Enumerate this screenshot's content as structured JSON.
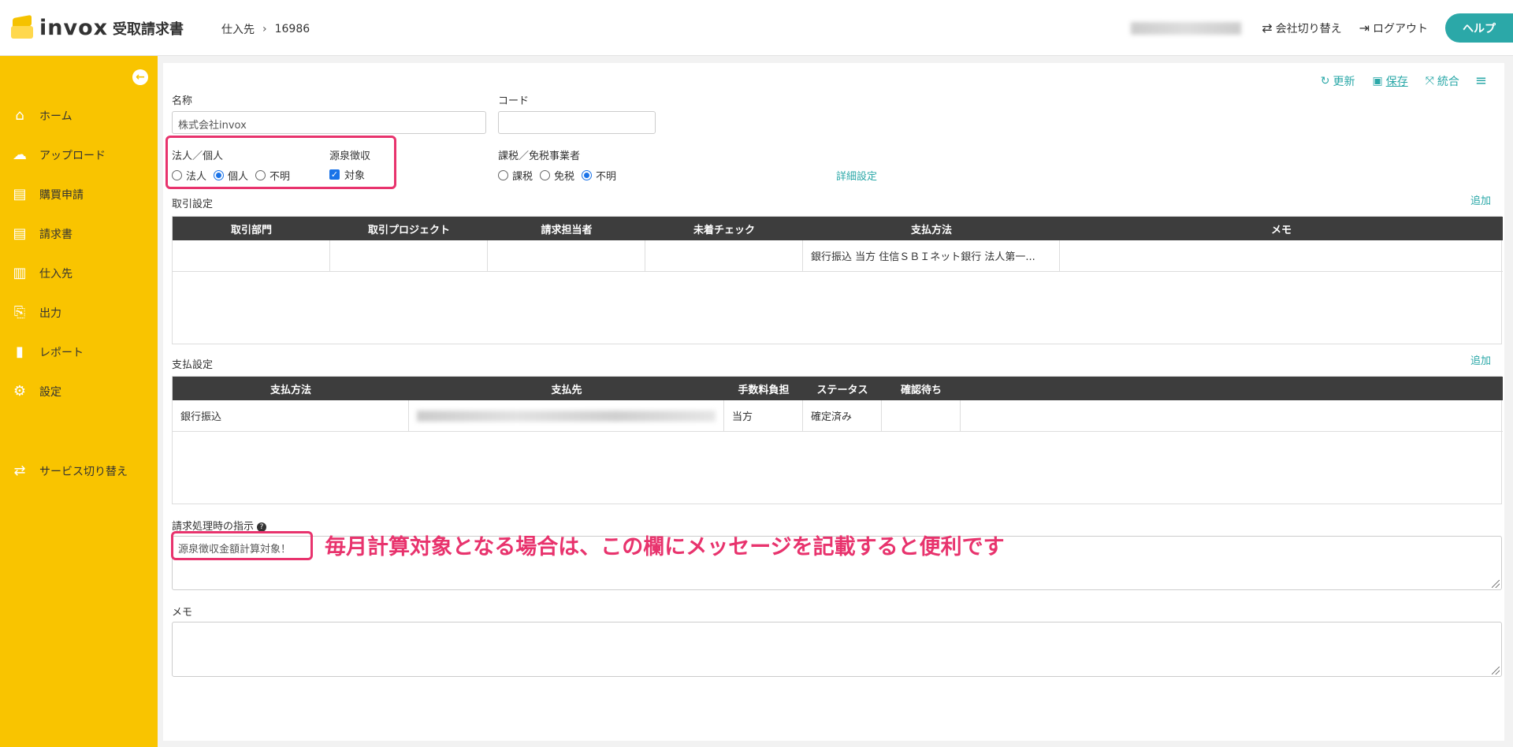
{
  "header": {
    "logo_text": "invox",
    "logo_sub": "受取請求書",
    "breadcrumb": [
      "仕入先",
      "16986"
    ],
    "switch_company": "会社切り替え",
    "logout": "ログアウト",
    "help": "ヘルプ"
  },
  "sidebar": {
    "items": [
      {
        "label": "ホーム",
        "icon": "home-icon"
      },
      {
        "label": "アップロード",
        "icon": "cloud-upload-icon"
      },
      {
        "label": "購買申請",
        "icon": "document-icon"
      },
      {
        "label": "請求書",
        "icon": "document-icon"
      },
      {
        "label": "仕入先",
        "icon": "building-icon"
      },
      {
        "label": "出力",
        "icon": "export-icon"
      },
      {
        "label": "レポート",
        "icon": "chart-icon"
      },
      {
        "label": "設定",
        "icon": "gear-icon"
      },
      {
        "label": "サービス切り替え",
        "icon": "switch-icon"
      }
    ]
  },
  "toolbar": {
    "refresh": "更新",
    "save": "保存",
    "merge": "統合"
  },
  "form": {
    "name_label": "名称",
    "name_value": "株式会社invox",
    "code_label": "コード",
    "code_value": "",
    "entity_label": "法人／個人",
    "entity_options": [
      "法人",
      "個人",
      "不明"
    ],
    "entity_selected": "個人",
    "withholding_label": "源泉徴収",
    "withholding_option": "対象",
    "withholding_checked": true,
    "tax_label": "課税／免税事業者",
    "tax_options": [
      "課税",
      "免税",
      "不明"
    ],
    "tax_selected": "不明",
    "detail_link": "詳細設定"
  },
  "trade": {
    "title": "取引設定",
    "add": "追加",
    "columns": [
      "取引部門",
      "取引プロジェクト",
      "請求担当者",
      "未着チェック",
      "支払方法",
      "メモ"
    ],
    "rows": [
      [
        "",
        "",
        "",
        "",
        "銀行振込 当方 住信ＳＢＩネット銀行 法人第一...",
        ""
      ]
    ]
  },
  "payment": {
    "title": "支払設定",
    "add": "追加",
    "columns": [
      "支払方法",
      "支払先",
      "手数料負担",
      "ステータス",
      "確認待ち"
    ],
    "rows": [
      [
        "銀行振込",
        "",
        "当方",
        "確定済み",
        ""
      ]
    ]
  },
  "instructions": {
    "label": "請求処理時の指示",
    "value": "源泉徴収金額計算対象！"
  },
  "memo": {
    "label": "メモ",
    "value": ""
  },
  "annotation": "毎月計算対象となる場合は、この欄にメッセージを記載すると便利です",
  "colors": {
    "accent": "#2ba8a8",
    "sidebar": "#f9c400",
    "highlight": "#e8336d",
    "table_header": "#3d3d3d"
  }
}
